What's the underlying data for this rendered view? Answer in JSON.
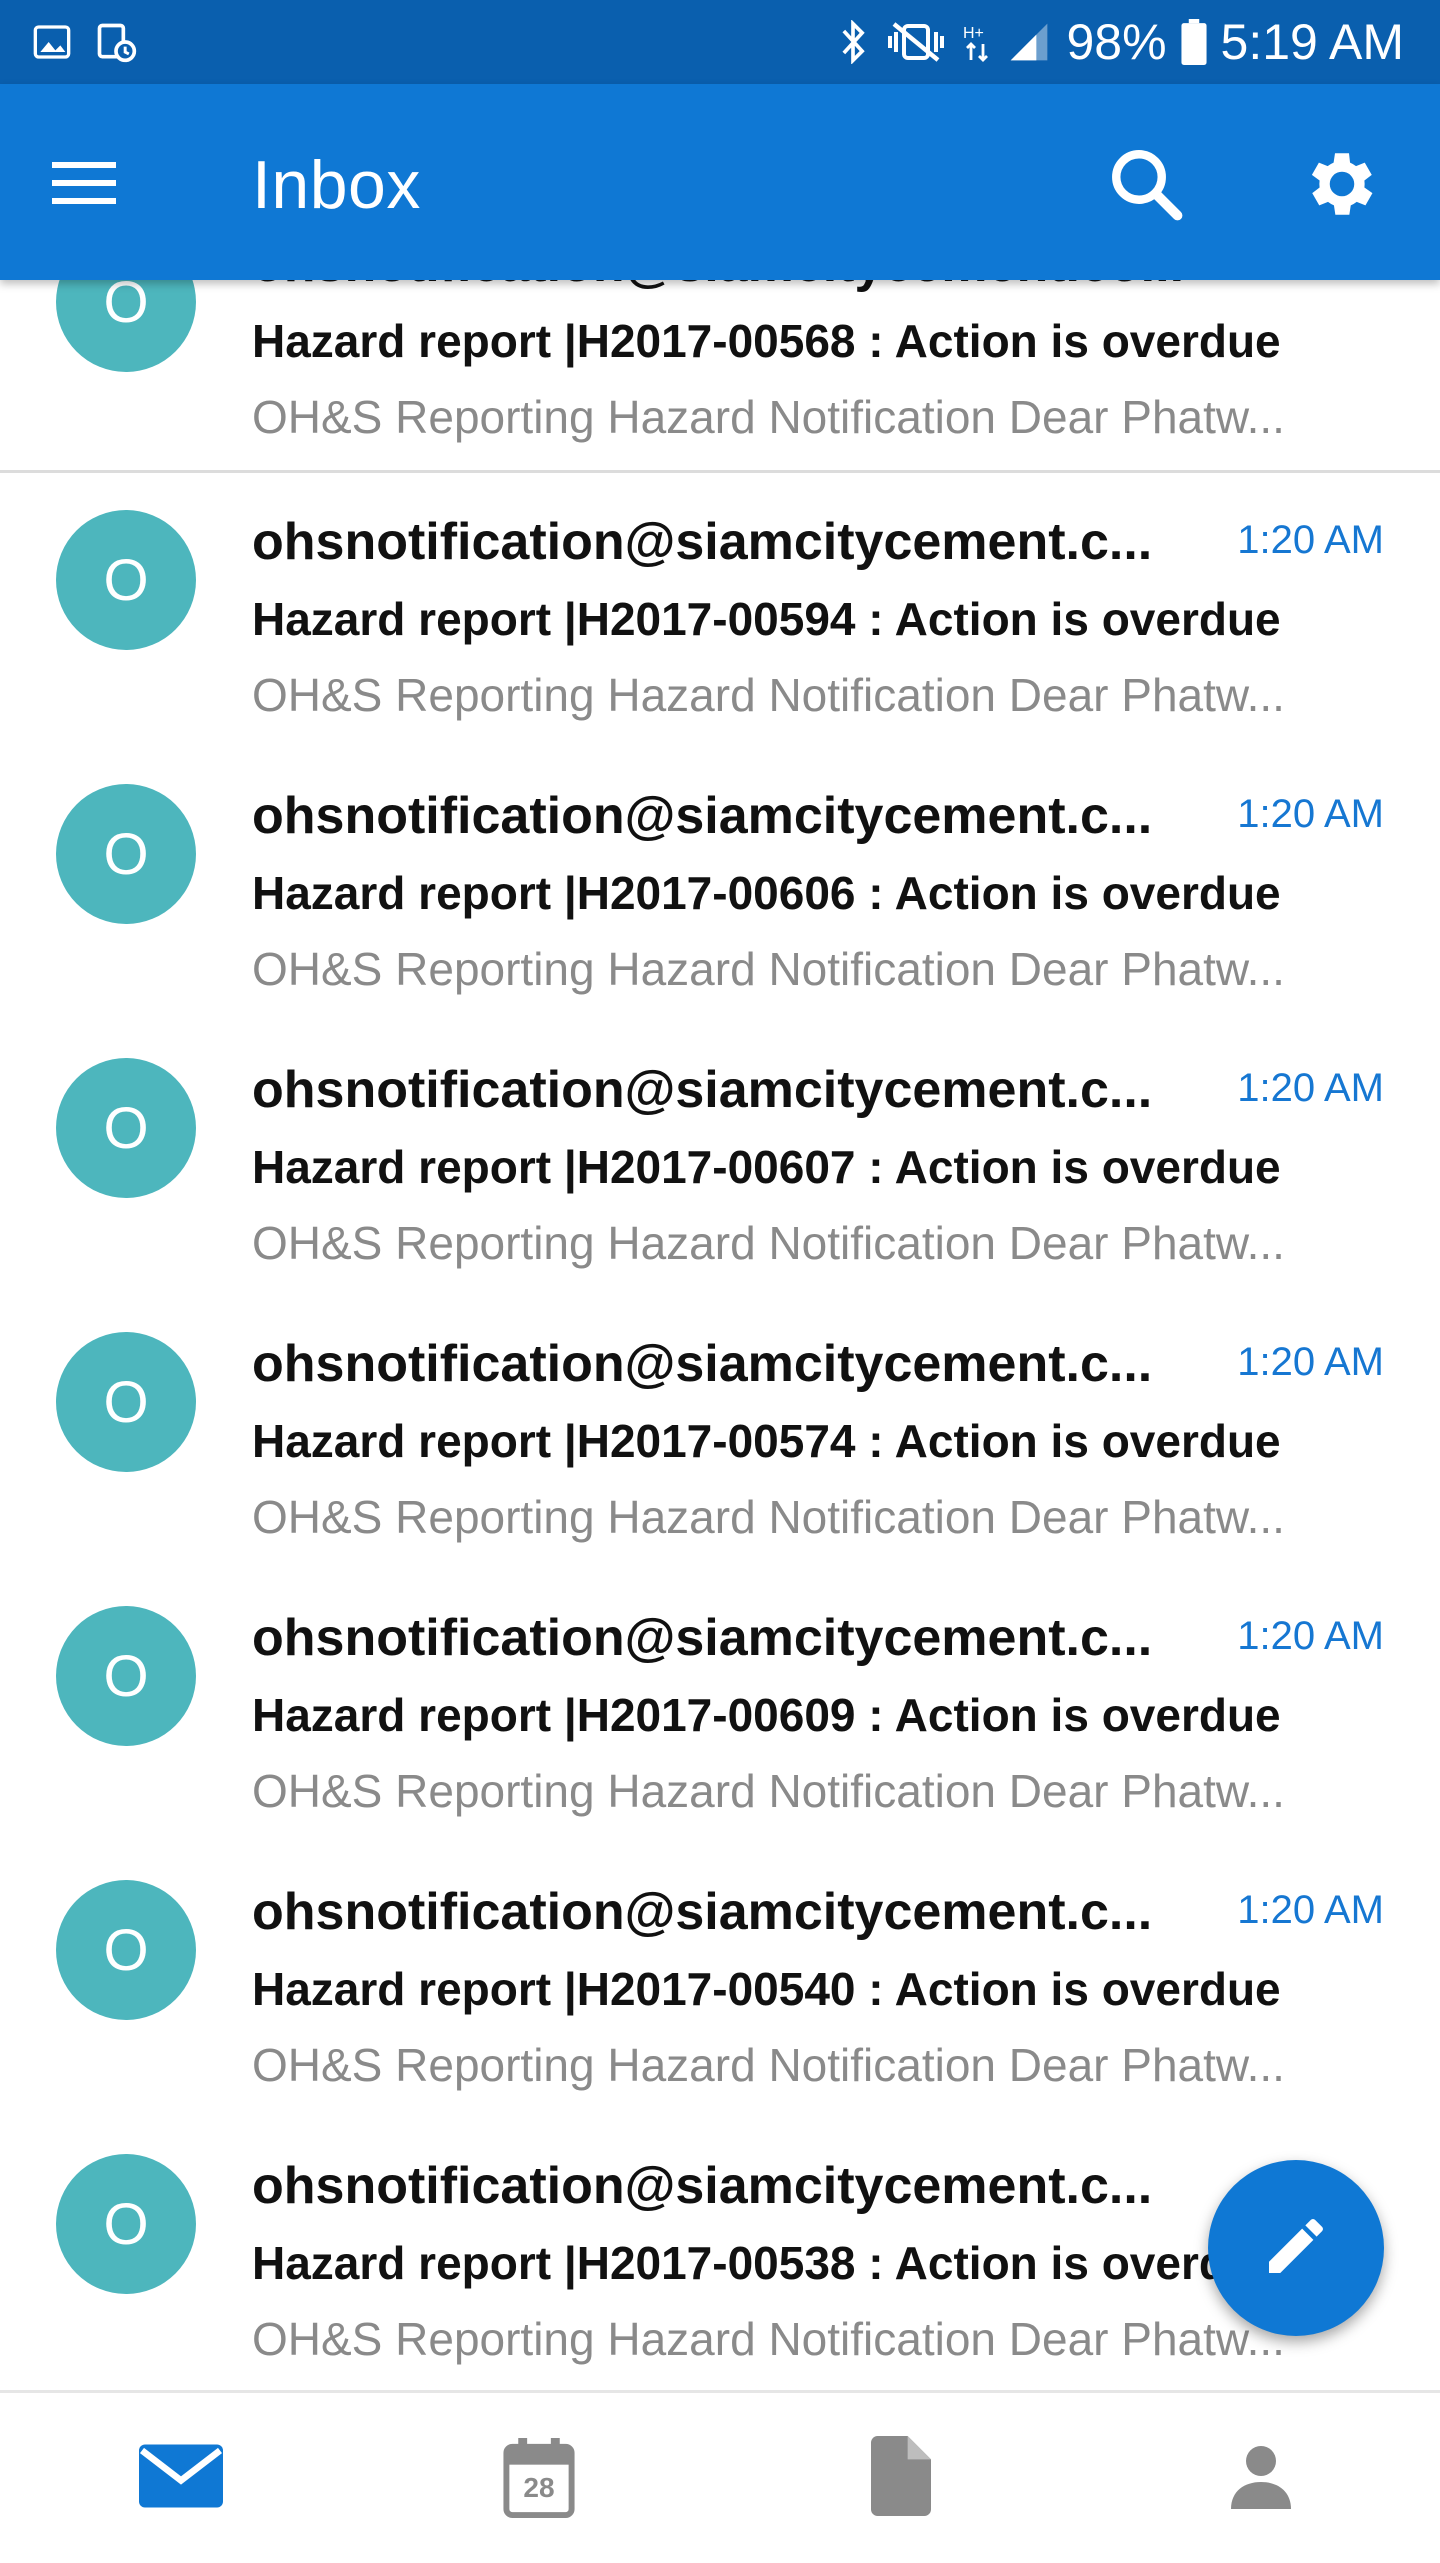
{
  "status_bar": {
    "battery": "98%",
    "time": "5:19 AM"
  },
  "app_bar": {
    "title": "Inbox"
  },
  "messages": [
    {
      "avatar_letter": "O",
      "sender": "ohsnotification@siamcitycement.co...",
      "time": "",
      "subject": "Hazard report |H2017-00568 : Action is overdue",
      "preview": "OH&S Reporting Hazard Notification Dear Phatw..."
    },
    {
      "avatar_letter": "O",
      "sender": "ohsnotification@siamcitycement.c...",
      "time": "1:20 AM",
      "subject": "Hazard report |H2017-00594 : Action is overdue",
      "preview": "OH&S Reporting Hazard Notification Dear Phatw..."
    },
    {
      "avatar_letter": "O",
      "sender": "ohsnotification@siamcitycement.c...",
      "time": "1:20 AM",
      "subject": "Hazard report |H2017-00606 : Action is overdue",
      "preview": "OH&S Reporting Hazard Notification Dear Phatw..."
    },
    {
      "avatar_letter": "O",
      "sender": "ohsnotification@siamcitycement.c...",
      "time": "1:20 AM",
      "subject": "Hazard report |H2017-00607 : Action is overdue",
      "preview": "OH&S Reporting Hazard Notification Dear Phatw..."
    },
    {
      "avatar_letter": "O",
      "sender": "ohsnotification@siamcitycement.c...",
      "time": "1:20 AM",
      "subject": "Hazard report |H2017-00574 : Action is overdue",
      "preview": "OH&S Reporting Hazard Notification Dear Phatw..."
    },
    {
      "avatar_letter": "O",
      "sender": "ohsnotification@siamcitycement.c...",
      "time": "1:20 AM",
      "subject": "Hazard report |H2017-00609 : Action is overdue",
      "preview": "OH&S Reporting Hazard Notification Dear Phatw..."
    },
    {
      "avatar_letter": "O",
      "sender": "ohsnotification@siamcitycement.c...",
      "time": "1:20 AM",
      "subject": "Hazard report |H2017-00540 : Action is overdue",
      "preview": "OH&S Reporting Hazard Notification Dear Phatw..."
    },
    {
      "avatar_letter": "O",
      "sender": "ohsnotification@siamcitycement.c...",
      "time": "",
      "subject": "Hazard report |H2017-00538 : Action is overdue",
      "preview": "OH&S Reporting Hazard Notification Dear Phatw..."
    }
  ],
  "bottom_nav": {
    "calendar_day": "28",
    "items": [
      "mail-icon",
      "calendar-icon",
      "files-icon",
      "people-icon"
    ]
  },
  "icons": {
    "menu": "hamburger-menu-icon",
    "search": "search-icon",
    "settings": "gear-icon",
    "compose": "pencil-icon"
  },
  "colors": {
    "status_bar": "#0a5fae",
    "app_bar": "#0f78d4",
    "avatar": "#4db6bd",
    "time": "#1677d2",
    "selected_nav": "#0f78d4",
    "inactive_nav": "#8a8a8a"
  }
}
